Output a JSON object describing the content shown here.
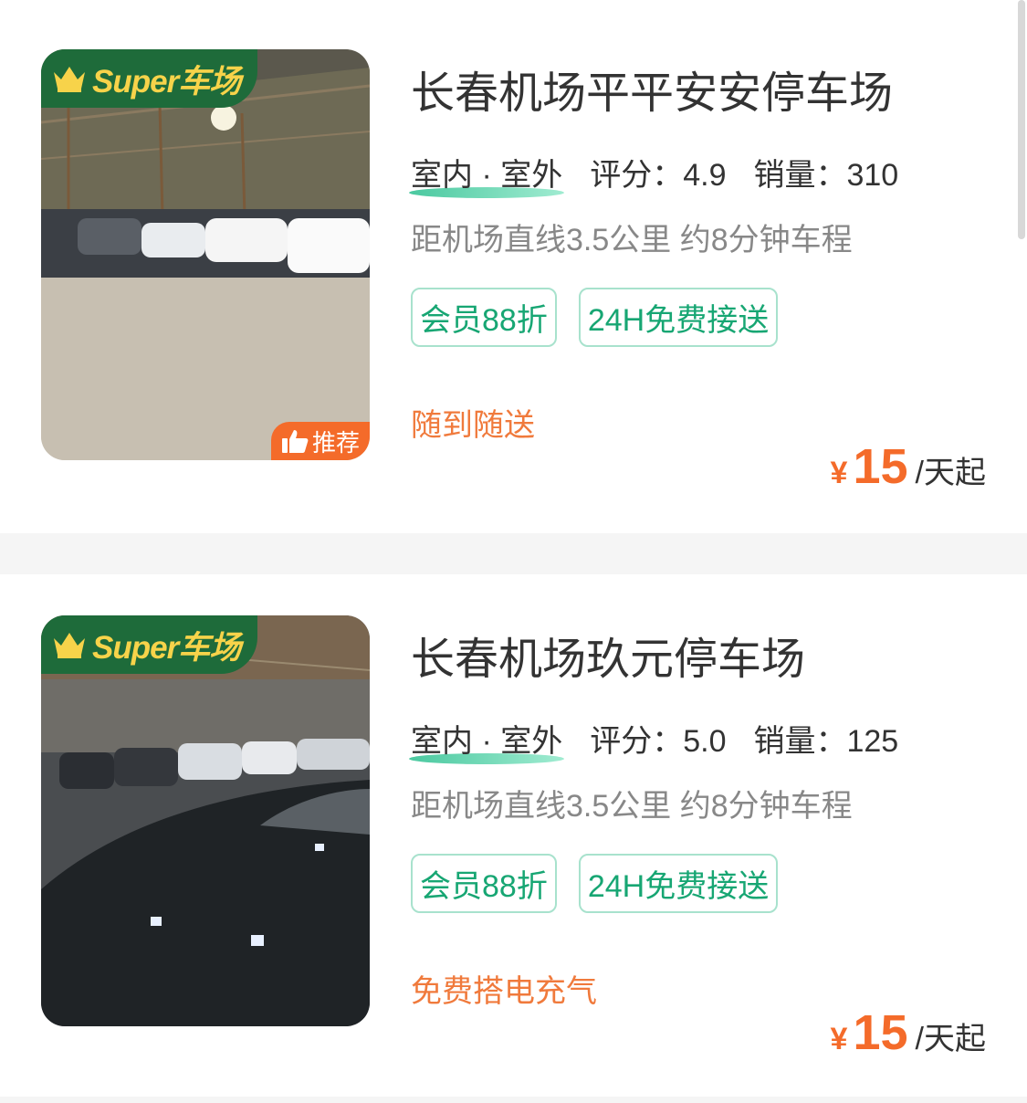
{
  "colors": {
    "brand_green": "#1e6b3a",
    "accent_orange": "#f46b2a",
    "tag_green": "#17a673",
    "super_gold": "#f7d34a"
  },
  "badges": {
    "super_label": "Super车场",
    "recommend_label": "推荐"
  },
  "lots": [
    {
      "title": "长春机场平平安安停车场",
      "type": "室内 · 室外",
      "rating_label": "评分：4.9",
      "sales_label": "销量：310",
      "distance": "距机场直线3.5公里 约8分钟车程",
      "tags": [
        "会员88折",
        "24H免费接送"
      ],
      "feature": "随到随送",
      "price_currency": "¥",
      "price_value": "15",
      "price_unit": "/天起",
      "recommended": true
    },
    {
      "title": "长春机场玖元停车场",
      "type": "室内 · 室外",
      "rating_label": "评分：5.0",
      "sales_label": "销量：125",
      "distance": "距机场直线3.5公里 约8分钟车程",
      "tags": [
        "会员88折",
        "24H免费接送"
      ],
      "feature": "免费搭电充气",
      "price_currency": "¥",
      "price_value": "15",
      "price_unit": "/天起",
      "recommended": false
    }
  ]
}
